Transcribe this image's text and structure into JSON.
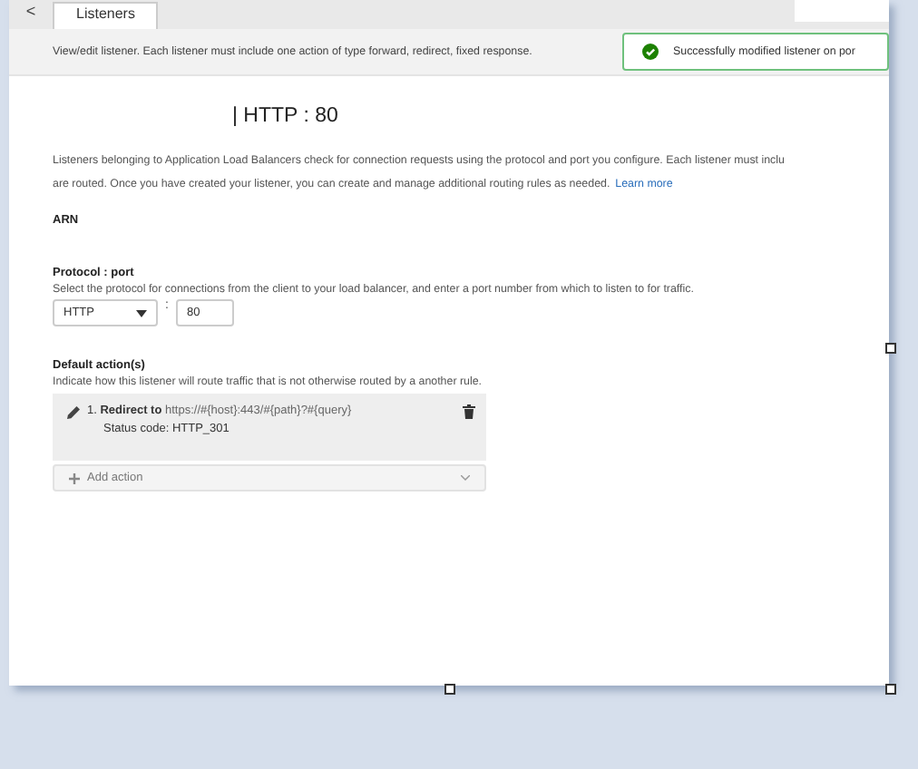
{
  "tab_bar": {
    "back": "<",
    "tabs": [
      {
        "label": "Listeners",
        "selected": true
      }
    ]
  },
  "info_bar": {
    "text": "View/edit listener. Each listener must include one action of type forward, redirect, fixed response.",
    "alert": "Successfully modified listener on por"
  },
  "heading": "| HTTP : 80",
  "intro": {
    "lines": [
      "Listeners belonging to Application Load Balancers check for connection requests using the protocol and port you configure. Each listener must inclu",
      "are routed. Once you have created your listener, you can create and manage additional routing rules as needed."
    ],
    "link": "Learn more"
  },
  "arn_label": "ARN",
  "protocol_port": {
    "label": "Protocol : port",
    "help": "Select the protocol for connections from the client to your load balancer, and enter a port number from which to listen to for traffic.",
    "protocol": "HTTP",
    "separator": ":",
    "port": "80"
  },
  "default_actions": {
    "label": "Default action(s)",
    "help": "Indicate how this listener will route traffic that is not otherwise routed by a another rule.",
    "actions": [
      {
        "number": "1.",
        "type": "Redirect to",
        "target": "https://#{host}:443/#{path}?#{query}",
        "detail": "Status code: HTTP_301"
      }
    ],
    "add_action": "Add action"
  }
}
